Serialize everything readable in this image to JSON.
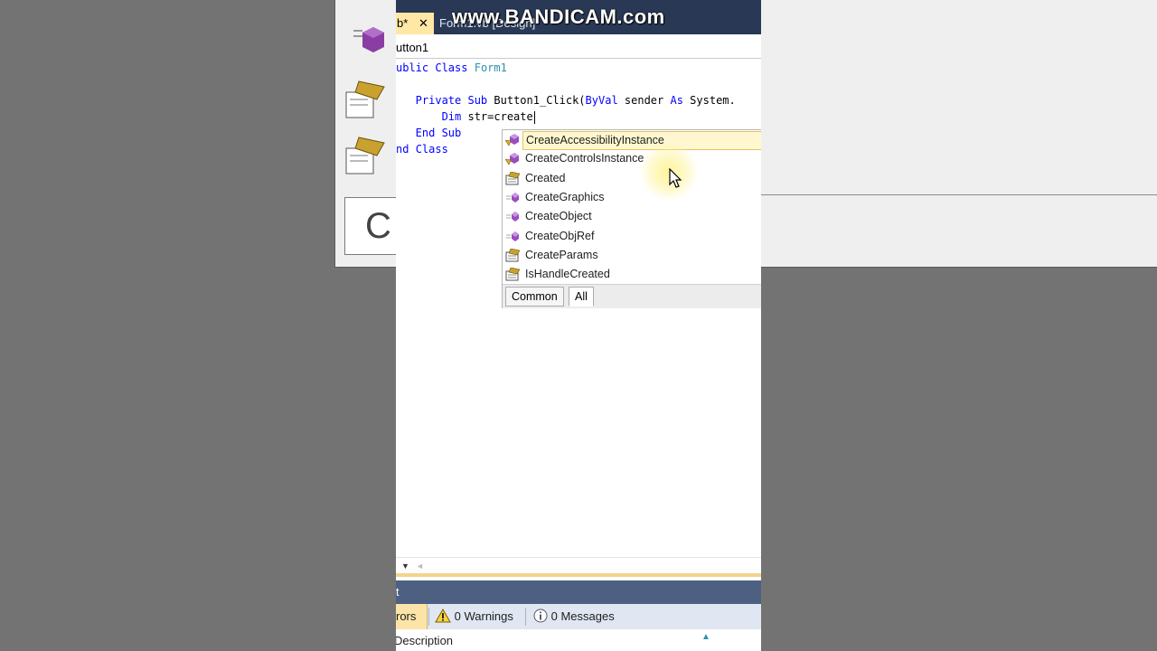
{
  "watermark": "www.BANDICAM.com",
  "tabs": [
    {
      "label": "b*",
      "close": "✕"
    },
    {
      "label": "Form1.vb [Design]"
    }
  ],
  "breadcrumb": "utton1",
  "code_lines": [
    {
      "parts": [
        {
          "t": "ublic ",
          "c": "kw"
        },
        {
          "t": "Class ",
          "c": "kw"
        },
        {
          "t": "Form1",
          "c": "ty"
        }
      ]
    },
    {
      "parts": []
    },
    {
      "parts": [
        {
          "t": "   Private ",
          "c": "kw"
        },
        {
          "t": "Sub ",
          "c": "kw"
        },
        {
          "t": "Button1_Click(",
          "c": ""
        },
        {
          "t": "ByVal ",
          "c": "kw"
        },
        {
          "t": "sender ",
          "c": ""
        },
        {
          "t": "As ",
          "c": "kw"
        },
        {
          "t": "System.",
          "c": ""
        }
      ]
    },
    {
      "parts": [
        {
          "t": "       Dim ",
          "c": "kw"
        },
        {
          "t": "str=create",
          "c": ""
        }
      ],
      "caret": true
    },
    {
      "parts": [
        {
          "t": "   End ",
          "c": "kw"
        },
        {
          "t": "Sub",
          "c": "kw"
        }
      ]
    },
    {
      "parts": [
        {
          "t": "nd ",
          "c": "kw"
        },
        {
          "t": "Class",
          "c": "kw"
        }
      ]
    }
  ],
  "intellisense": {
    "items": [
      {
        "label": "CreateAccessibilityInstance",
        "icon": "method-protected-icon",
        "selected": true
      },
      {
        "label": "CreateControlsInstance",
        "icon": "method-protected-icon"
      },
      {
        "label": "Created",
        "icon": "property-icon"
      },
      {
        "label": "CreateGraphics",
        "icon": "method-icon"
      },
      {
        "label": "CreateObject",
        "icon": "method-icon"
      },
      {
        "label": "CreateObjRef",
        "icon": "method-icon"
      },
      {
        "label": "CreateParams",
        "icon": "property-icon"
      },
      {
        "label": "IsHandleCreated",
        "icon": "property-icon"
      }
    ],
    "tabs": [
      "Common",
      "All"
    ],
    "active_tab": "All"
  },
  "error_list": {
    "title": "t",
    "errors_label": "rors",
    "warnings_label": "0 Warnings",
    "messages_label": "0 Messages",
    "column_description": "Description"
  },
  "colors": {
    "tab_bar": "#293955",
    "active_tab": "#ffe8a6",
    "keyword": "#0000ff",
    "type": "#2b91af",
    "selected_item_bg": "#fff7cf"
  }
}
